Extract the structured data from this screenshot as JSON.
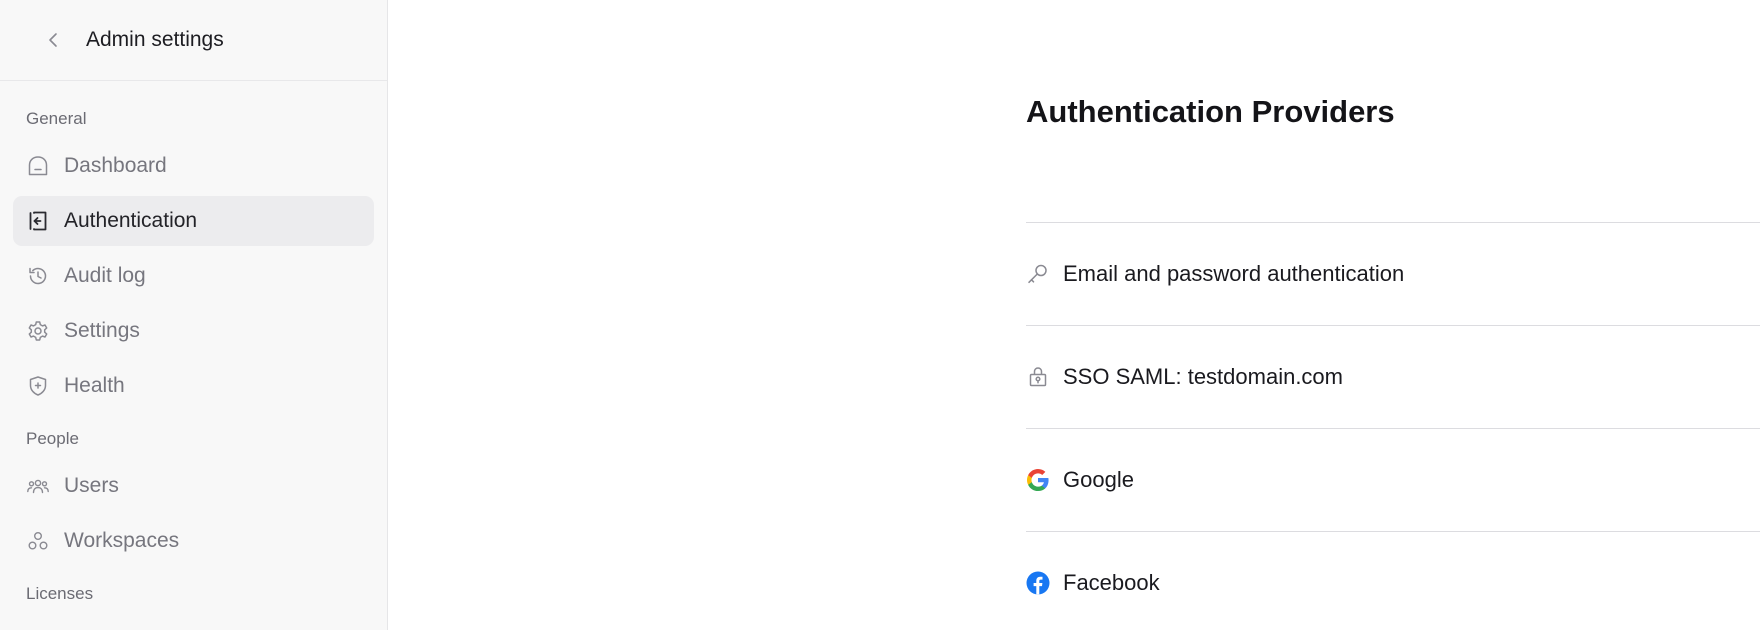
{
  "sidebar": {
    "header": {
      "title": "Admin settings"
    },
    "sections": {
      "general": {
        "label": "General",
        "items": [
          {
            "label": "Dashboard"
          },
          {
            "label": "Authentication",
            "active": true
          },
          {
            "label": "Audit log"
          },
          {
            "label": "Settings"
          },
          {
            "label": "Health"
          }
        ]
      },
      "people": {
        "label": "People",
        "items": [
          {
            "label": "Users"
          },
          {
            "label": "Workspaces"
          }
        ]
      },
      "licenses": {
        "label": "Licenses"
      }
    }
  },
  "main": {
    "title": "Authentication Providers",
    "providers": [
      {
        "label": "Email and password authentication",
        "icon": "key-icon"
      },
      {
        "label": "SSO SAML: testdomain.com",
        "icon": "lock-icon"
      },
      {
        "label": "Google",
        "icon": "google-icon"
      },
      {
        "label": "Facebook",
        "icon": "facebook-icon"
      }
    ]
  },
  "colors": {
    "sidebar_bg": "#f8f8f8",
    "active_item_bg": "#ececee",
    "divider": "#dcdce0",
    "facebook_blue": "#1877F2"
  }
}
